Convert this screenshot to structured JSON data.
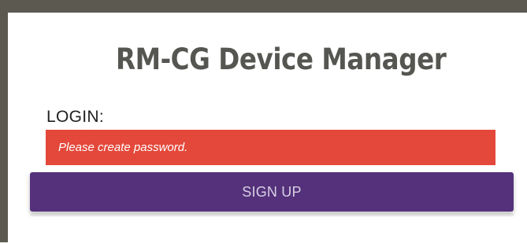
{
  "app": {
    "title": "RM-CG Device Manager"
  },
  "login": {
    "label": "LOGIN:",
    "placeholder": "Please create password."
  },
  "actions": {
    "signup_label": "SIGN UP"
  },
  "colors": {
    "background": "#ffffff",
    "frame": "#5c5a50",
    "title_text": "#555651",
    "password_field": "#e4483a",
    "primary_button": "#54317a"
  }
}
